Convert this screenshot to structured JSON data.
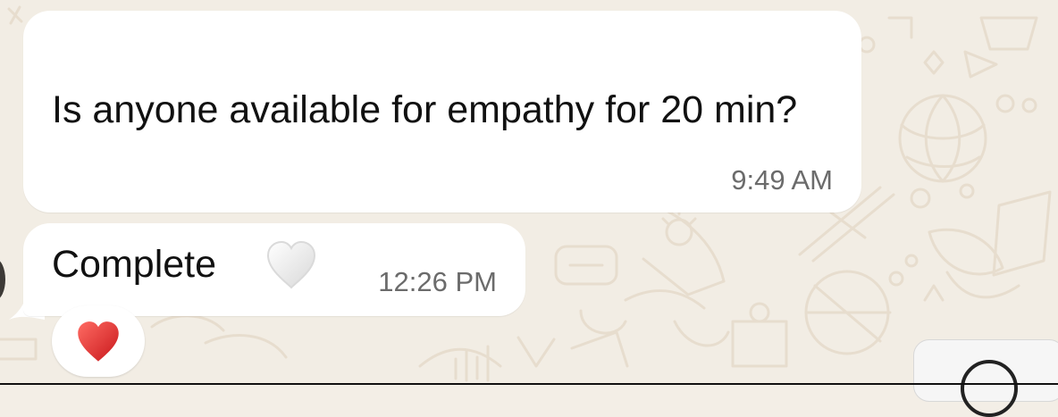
{
  "chat": {
    "messages": [
      {
        "sender": "",
        "text": "Is anyone available for empathy for 20 min?",
        "time": "9:49 AM"
      },
      {
        "text": "Complete",
        "emoji": "white-heart-icon",
        "time": "12:26 PM",
        "reaction": "red-heart-icon"
      }
    ]
  },
  "colors": {
    "background": "#f2ede4",
    "bubble": "#ffffff",
    "timestamp": "#6b6b6b",
    "sender": "#1fa58f",
    "reaction_heart": "#e5322f"
  }
}
